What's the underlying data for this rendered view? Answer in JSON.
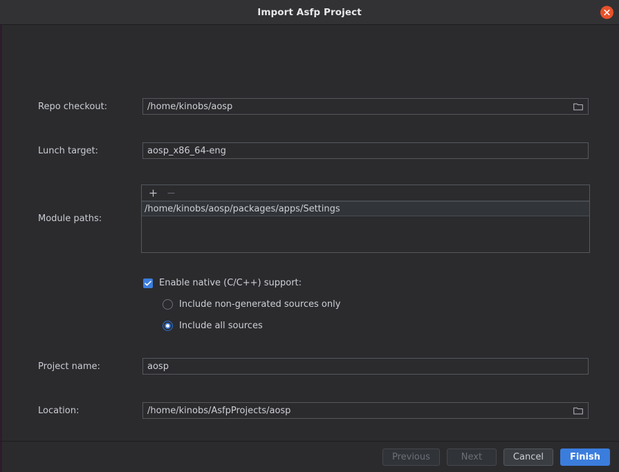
{
  "titlebar": {
    "title": "Import Asfp Project",
    "close_icon": "close-icon"
  },
  "form": {
    "repo_checkout": {
      "label": "Repo checkout:",
      "value": "/home/kinobs/aosp",
      "browse_icon": "folder-icon"
    },
    "lunch_target": {
      "label": "Lunch target:",
      "value": "aosp_x86_64-eng"
    },
    "module_paths": {
      "label": "Module paths:",
      "add_label": "+",
      "remove_label": "−",
      "items": [
        "/home/kinobs/aosp/packages/apps/Settings"
      ],
      "selected_index": 0
    },
    "native_support": {
      "label": "Enable native (C/C++) support:",
      "checked": true,
      "options": [
        {
          "label": "Include non-generated sources only",
          "selected": false
        },
        {
          "label": "Include all sources",
          "selected": true
        }
      ]
    },
    "project_name": {
      "label": "Project name:",
      "value": "aosp"
    },
    "location": {
      "label": "Location:",
      "value": "/home/kinobs/AsfpProjects/aosp",
      "browse_icon": "folder-icon"
    }
  },
  "footer": {
    "previous": "Previous",
    "next": "Next",
    "cancel": "Cancel",
    "finish": "Finish"
  },
  "colors": {
    "accent": "#3b7ddd",
    "close": "#e8512a",
    "background": "#2b2b2e",
    "titlebar": "#323235"
  }
}
